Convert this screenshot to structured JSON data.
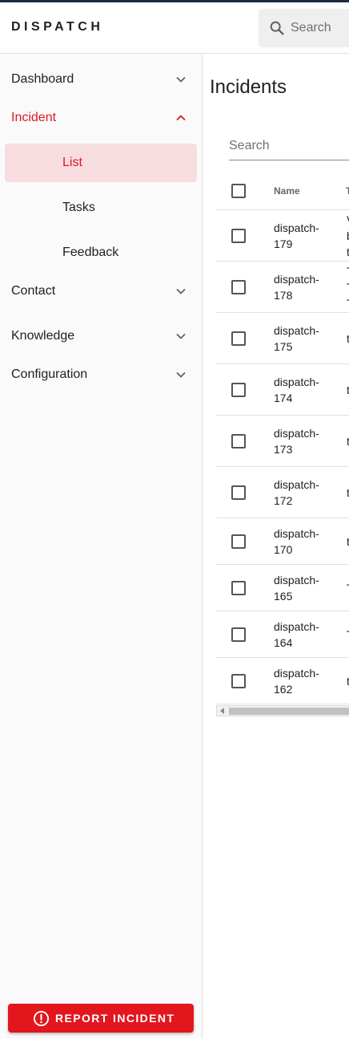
{
  "header": {
    "brand": "DISPATCH",
    "search_placeholder": "Search"
  },
  "sidebar": {
    "items": [
      {
        "label": "Dashboard",
        "icon": "chevron-down-icon"
      },
      {
        "label": "Incident",
        "icon": "chevron-up-icon",
        "active": true,
        "children": [
          {
            "label": "List",
            "selected": true
          },
          {
            "label": "Tasks"
          },
          {
            "label": "Feedback"
          }
        ]
      },
      {
        "label": "Contact",
        "icon": "chevron-down-icon"
      },
      {
        "label": "Knowledge",
        "icon": "chevron-down-icon"
      },
      {
        "label": "Configuration",
        "icon": "chevron-down-icon"
      }
    ],
    "report_button": "REPORT INCIDENT"
  },
  "main": {
    "title": "Incidents",
    "search_placeholder": "Search",
    "table": {
      "headers": [
        "Name",
        "T"
      ],
      "rows": [
        {
          "name": "dispatch-179",
          "title_lines": [
            "V",
            "b",
            "t"
          ]
        },
        {
          "name": "dispatch-178",
          "title_lines": [
            "T",
            "T",
            "T"
          ]
        },
        {
          "name": "dispatch-175",
          "title_lines": [
            "t"
          ]
        },
        {
          "name": "dispatch-174",
          "title_lines": [
            "t"
          ]
        },
        {
          "name": "dispatch-173",
          "title_lines": [
            "t"
          ]
        },
        {
          "name": "dispatch-172",
          "title_lines": [
            "t"
          ]
        },
        {
          "name": "dispatch-170",
          "title_lines": [
            "t"
          ]
        },
        {
          "name": "dispatch-165",
          "title_lines": [
            "T"
          ]
        },
        {
          "name": "dispatch-164",
          "title_lines": [
            "T"
          ]
        },
        {
          "name": "dispatch-162",
          "title_lines": [
            "t"
          ]
        }
      ]
    }
  },
  "colors": {
    "accent": "#e0161f",
    "selected_bg": "#f7dde0",
    "topstrip": "#1f2a44"
  }
}
